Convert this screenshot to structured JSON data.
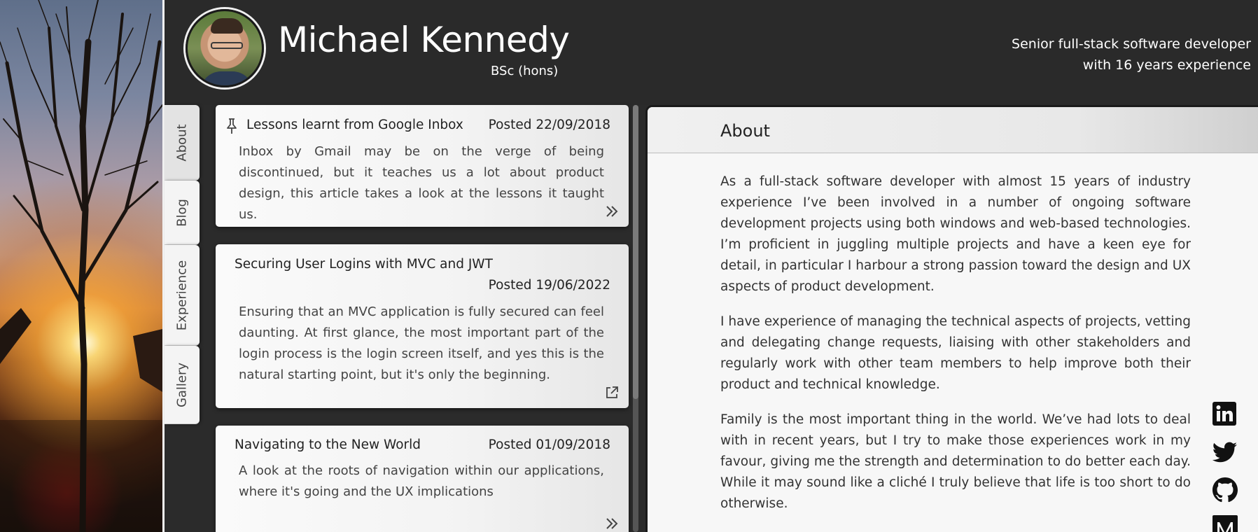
{
  "header": {
    "name": "Michael Kennedy",
    "degree": "BSc (hons)",
    "tagline_line1": "Senior full-stack software developer",
    "tagline_line2": "with 16 years experience"
  },
  "tabs": [
    {
      "label": "About"
    },
    {
      "label": "Blog"
    },
    {
      "label": "Experience"
    },
    {
      "label": "Gallery"
    }
  ],
  "blog": {
    "posts": [
      {
        "title": "Lessons learnt from Google Inbox",
        "date": "Posted 22/09/2018",
        "body": "Inbox by Gmail may be on the verge of being discontinued, but it teaches us a lot about product design, this article takes a look at the lessons it taught us.",
        "pinned": true,
        "action_icon": "double-chevron-right-icon"
      },
      {
        "title": "Securing User Logins with MVC and JWT",
        "date": "Posted 19/06/2022",
        "body": "Ensuring that an MVC application is fully secured can feel daunting. At first glance, the most important part of the login process is the login screen itself, and yes this is the natural starting point, but it's only the beginning.",
        "pinned": false,
        "action_icon": "external-link-icon"
      },
      {
        "title": "Navigating to the New World",
        "date": "Posted 01/09/2018",
        "body": "A look at the roots of navigation within our applications, where it's going and the UX implications",
        "pinned": false,
        "action_icon": "double-chevron-right-icon"
      }
    ]
  },
  "about": {
    "title": "About",
    "paragraphs": [
      "As a full-stack software developer with almost 15 years of industry experience I’ve been involved in a number of ongoing software development projects using both windows and web-based technologies. I’m proficient in juggling multiple projects and have a keen eye for detail, in particular I harbour a strong passion toward the design and UX aspects of product development.",
      "I have experience of managing the technical aspects of projects, vetting and delegating change requests, liaising with other stakeholders and regularly work with other team members to help improve both their product and technical knowledge.",
      "Family is the most important thing in the world. We’ve had lots to deal with in recent years, but I try to make those experiences work in my favour, giving me the strength and determination to do better each day. While it may sound like a cliché I truly believe that life is too short to do otherwise."
    ]
  },
  "social": [
    "linkedin-icon",
    "twitter-icon",
    "github-icon",
    "medium-icon"
  ],
  "colors": {
    "header_bg": "#2a2a2a",
    "panel_bg": "#f7f7f7",
    "card_bg": "#f5f5f5"
  }
}
